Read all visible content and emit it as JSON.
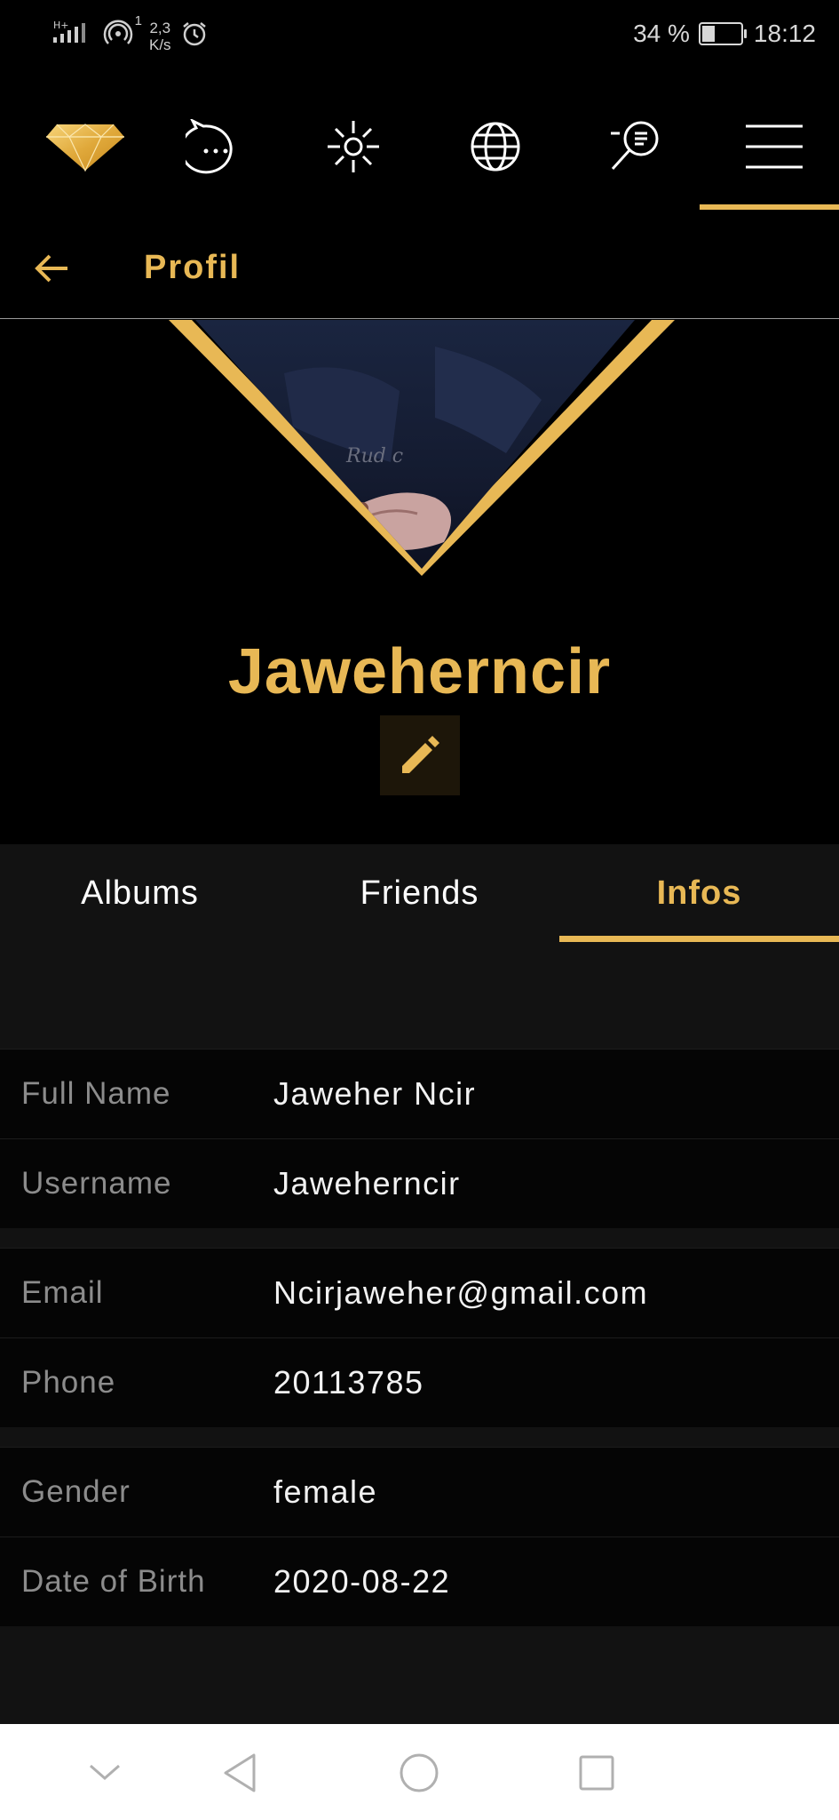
{
  "status_bar": {
    "network": "H+",
    "wifi_badge": "1",
    "speed_value": "2,3",
    "speed_unit": "K/s",
    "battery": "34 %",
    "battery_level": 0.34,
    "time": "18:12"
  },
  "top_nav": {
    "icons": [
      "diamond-icon",
      "chat-bubble-icon",
      "sun-icon",
      "globe-icon",
      "search-chat-icon",
      "menu-icon"
    ],
    "active_index": 5,
    "accent": "#e8b855"
  },
  "header": {
    "back_icon": "arrow-left-icon",
    "title": "Profil"
  },
  "profile": {
    "username": "Jaweherncir",
    "edit_icon": "pencil-icon"
  },
  "tabs": {
    "items": [
      "Albums",
      "Friends",
      "Infos"
    ],
    "active": "Infos"
  },
  "info": {
    "groups": [
      [
        {
          "label": "Full Name",
          "value": "Jaweher Ncir"
        },
        {
          "label": "Username",
          "value": "Jaweherncir"
        }
      ],
      [
        {
          "label": "Email",
          "value": "Ncirjaweher@gmail.com"
        },
        {
          "label": "Phone",
          "value": "20113785"
        }
      ],
      [
        {
          "label": "Gender",
          "value": "female"
        },
        {
          "label": "Date of Birth",
          "value": "2020-08-22"
        }
      ]
    ]
  },
  "system_nav": {
    "icons": [
      "chevron-down-icon",
      "back-triangle-icon",
      "home-circle-icon",
      "recents-square-icon"
    ]
  },
  "colors": {
    "background": "#000000",
    "accent": "#e8b855",
    "panel": "#121212"
  }
}
